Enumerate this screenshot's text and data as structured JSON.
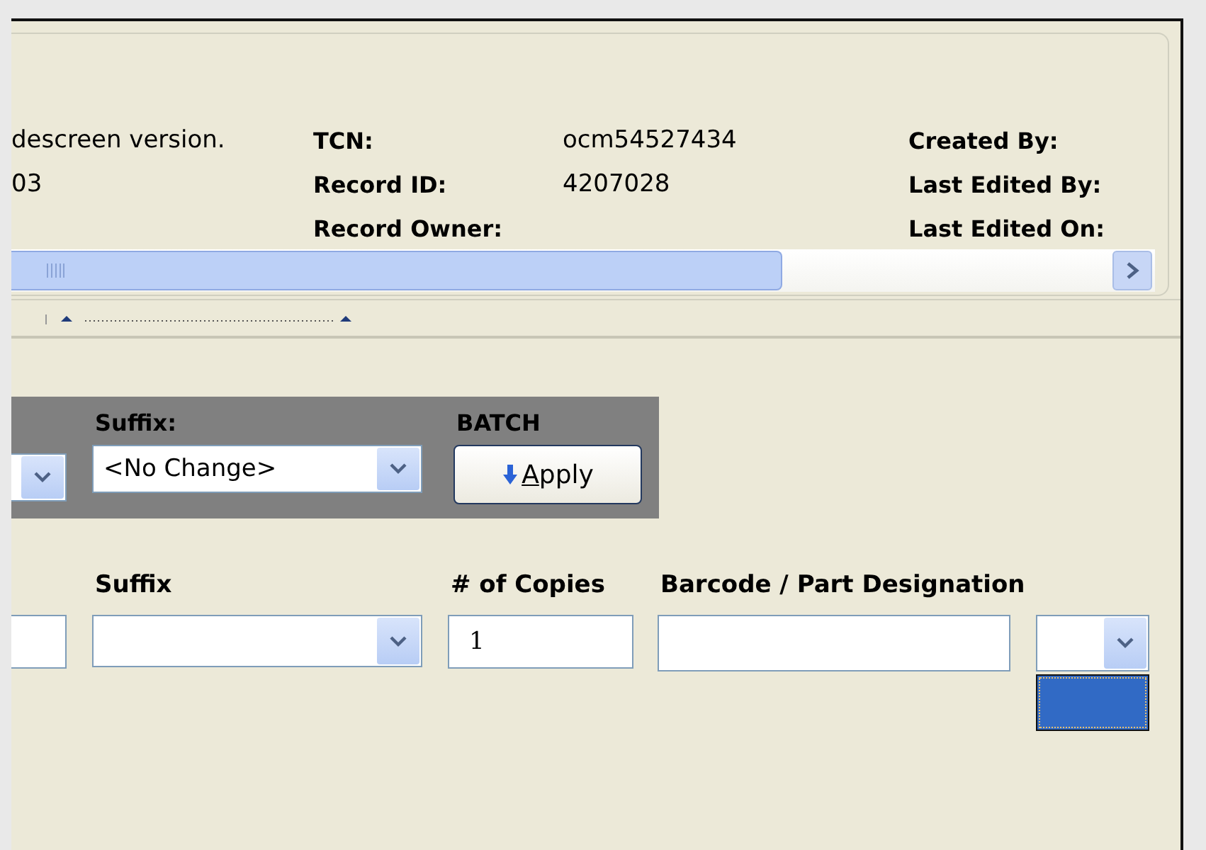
{
  "header": {
    "notes": [
      "descreen version.",
      "03"
    ],
    "fields": [
      {
        "label": "TCN:",
        "value": "ocm54527434"
      },
      {
        "label": "Record ID:",
        "value": "4207028"
      },
      {
        "label": "Record Owner:"
      }
    ],
    "audit": [
      "Created By:",
      "Last Edited By:",
      "Last Edited On:"
    ]
  },
  "batch": {
    "suffix_label": "Suffix:",
    "suffix_value": "<No Change>",
    "title": "BATCH",
    "apply": "Apply"
  },
  "columns": [
    "Suffix",
    "# of Copies",
    "Barcode / Part Designation"
  ],
  "row": {
    "copies": "1"
  },
  "dropdown_item": {
    "selected": true
  }
}
